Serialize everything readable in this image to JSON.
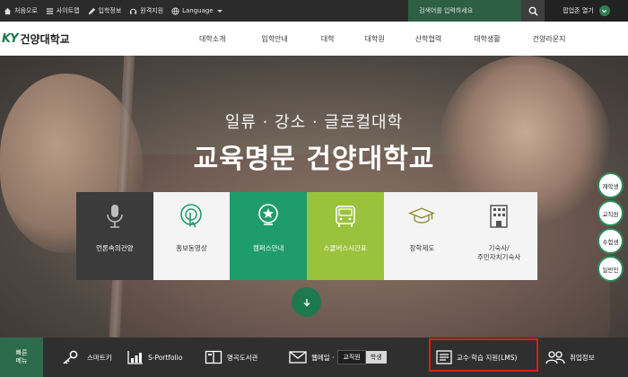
{
  "topbar": {
    "items": [
      {
        "label": "처음으로",
        "icon": "home-icon"
      },
      {
        "label": "사이트맵",
        "icon": "menu-icon"
      },
      {
        "label": "입학정보",
        "icon": "pencil-icon"
      },
      {
        "label": "원격지원",
        "icon": "headset-icon"
      },
      {
        "label": "Language",
        "icon": "globe-icon"
      }
    ],
    "search_placeholder": "검색어를 입력하세요",
    "popup_label": "팝업존 열기"
  },
  "header": {
    "logo_mark": "KY",
    "logo_text": "건양대학교",
    "nav": [
      "대학소개",
      "입학안내",
      "대학",
      "대학원",
      "산학협력",
      "대학생활",
      "건양라운지"
    ]
  },
  "hero": {
    "subtitle": "일류 · 강소 · 글로컬대학",
    "title": "교육명문 건양대학교",
    "tiles": [
      {
        "label": "언론속의건양",
        "icon": "microphone-icon",
        "bg": "#3b3b3b",
        "fg": "#ffffff"
      },
      {
        "label": "홍보동영상",
        "icon": "touch-play-icon",
        "bg": "#f4f4f4",
        "fg": "#333333"
      },
      {
        "label": "캠퍼스안내",
        "icon": "map-pin-star-icon",
        "bg": "#1f9c6b",
        "fg": "#ffffff"
      },
      {
        "label": "스쿨버스시간표",
        "icon": "bus-icon",
        "bg": "#9bc23c",
        "fg": "#ffffff"
      },
      {
        "label": "장학제도",
        "icon": "graduation-cap-icon",
        "bg": "#f4f4f4",
        "fg": "#333333"
      },
      {
        "label": "기숙사/\n주민자치기숙사",
        "icon": "building-icon",
        "bg": "#f4f4f4",
        "fg": "#333333"
      }
    ],
    "side_buttons": [
      "재학생",
      "교직원",
      "수험생",
      "일반인"
    ]
  },
  "quick": {
    "label_line1": "빠른",
    "label_line2": "메뉴",
    "items": {
      "smartkey": "스마트키",
      "portfolio": "S-Portfolio",
      "library": "명곡도서관",
      "webmail": "웹메일 ·",
      "staff": "교직원",
      "student": "학생",
      "lms": "교수·학습 지원(LMS)",
      "career": "취업정보"
    }
  },
  "colors": {
    "brand_green": "#1e7a4e",
    "highlight_red": "#e01b1b"
  }
}
